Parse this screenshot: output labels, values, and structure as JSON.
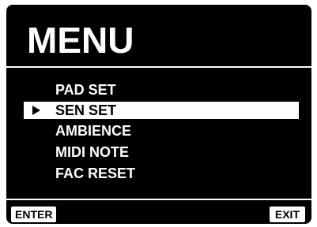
{
  "screen": {
    "title": "MENU"
  },
  "menu": {
    "items": [
      {
        "label": "PAD SET",
        "selected": false
      },
      {
        "label": "SEN SET",
        "selected": true
      },
      {
        "label": "AMBIENCE",
        "selected": false
      },
      {
        "label": "MIDI NOTE",
        "selected": false
      },
      {
        "label": "FAC RESET",
        "selected": false
      }
    ],
    "cursor_icon": "play-triangle-icon"
  },
  "softkeys": {
    "left_label": "ENTER",
    "right_label": "EXIT"
  },
  "colors": {
    "background": "#000000",
    "foreground": "#ffffff",
    "highlight_bg": "#ffffff",
    "highlight_fg": "#000000"
  }
}
